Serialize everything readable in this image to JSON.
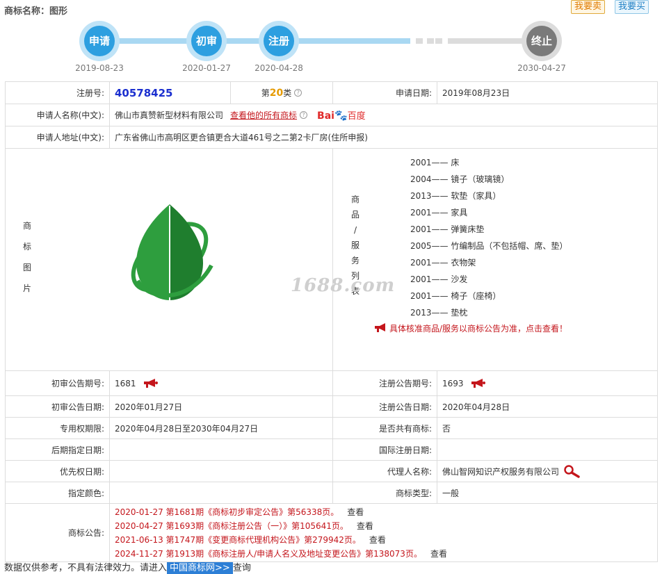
{
  "header": {
    "title": "商标名称：图形",
    "sell_label": "我要卖",
    "buy_label": "我要买"
  },
  "timeline": [
    {
      "label": "申请",
      "date": "2019-08-23",
      "state": "done"
    },
    {
      "label": "初审",
      "date": "2020-01-27",
      "state": "done"
    },
    {
      "label": "注册",
      "date": "2020-04-28",
      "state": "done"
    },
    {
      "label": "终止",
      "date": "2030-04-27",
      "state": "pending"
    }
  ],
  "info": {
    "reg_no_label": "注册号:",
    "reg_no": "40578425",
    "class_prefix": "第",
    "class_no": "20",
    "class_suffix": "类",
    "help_icon": "?",
    "apply_date_label": "申请日期:",
    "apply_date": "2019年08月23日",
    "applicant_label": "申请人名称(中文):",
    "applicant": "佛山市真赞新型材料有限公司",
    "applicant_link": "查看他的所有商标",
    "baidu_bai": "Bai",
    "baidu_du": "百度",
    "address_label": "申请人地址(中文):",
    "address": "广东省佛山市高明区更合镇更合大道461号之二第2卡厂房(住所申报)",
    "image_label": [
      "商",
      "标",
      "图",
      "片"
    ],
    "goods_label": [
      "商",
      "品",
      "/",
      "服",
      "务",
      "列",
      "表"
    ],
    "watermark": "1688.com",
    "goods": [
      "2001—— 床",
      "2004—— 镜子（玻璃镜）",
      "2013—— 软垫（家具）",
      "2001—— 家具",
      "2001—— 弹簧床垫",
      "2005—— 竹编制品（不包括帽、席、垫）",
      "2001—— 衣物架",
      "2001—— 沙发",
      "2001—— 椅子（座椅）",
      "2013—— 垫枕"
    ],
    "goods_note": "具体核准商品/服务以商标公告为准，点击查看！",
    "prelim_no_label": "初审公告期号:",
    "prelim_no": "1681",
    "reg_notice_no_label": "注册公告期号:",
    "reg_notice_no": "1693",
    "prelim_date_label": "初审公告日期:",
    "prelim_date": "2020年01月27日",
    "reg_notice_date_label": "注册公告日期:",
    "reg_notice_date": "2020年04月28日",
    "exclusive_label": "专用权期限:",
    "exclusive": "2020年04月28日至2030年04月27日",
    "shared_label": "是否共有商标:",
    "shared": "否",
    "later_label": "后期指定日期:",
    "later": "",
    "intl_label": "国际注册日期:",
    "intl": "",
    "priority_label": "优先权日期:",
    "priority": "",
    "agent_label": "代理人名称:",
    "agent": "佛山智网知识产权服务有限公司",
    "color_label": "指定颜色:",
    "color": "",
    "type_label": "商标类型:",
    "type": "一般",
    "notices_label": "商标公告:",
    "notices": [
      {
        "text": "2020-01-27 第1681期《商标初步审定公告》第56338页。",
        "view": "查看"
      },
      {
        "text": "2020-04-27 第1693期《商标注册公告（一）》第105641页。",
        "view": "查看"
      },
      {
        "text": "2021-06-13 第1747期《变更商标代理机构公告》第279942页。",
        "view": "查看"
      },
      {
        "text": "2024-11-27 第1913期《商标注册人/申请人名义及地址变更公告》第138073页。",
        "view": "查看"
      }
    ]
  },
  "footer": {
    "text": "数据仅供参考，不具有法律效力。请进入",
    "link": "中国商标网>>",
    "suffix": "查询"
  },
  "colors": {
    "accent_blue": "#2d9fe0",
    "accent_red": "#c4161c",
    "leaf_green": "#2e9e3e"
  }
}
